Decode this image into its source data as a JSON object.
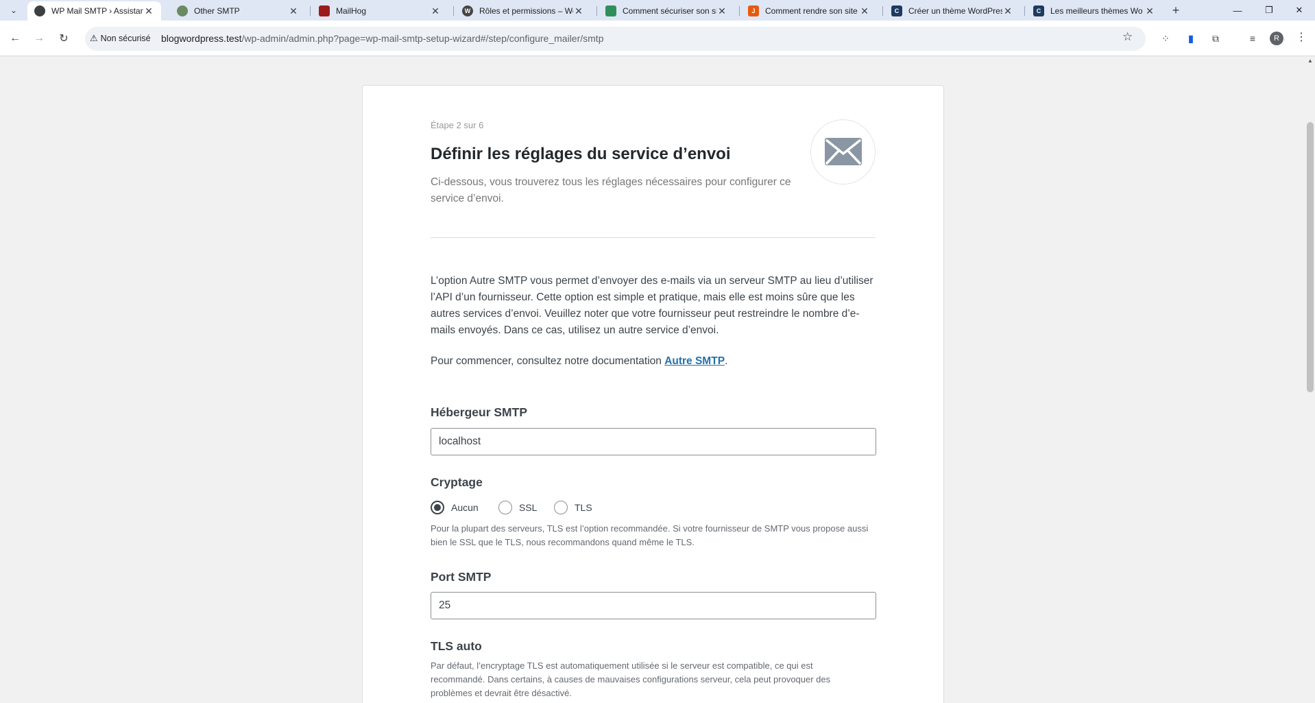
{
  "browser": {
    "tabs": [
      {
        "title": "WP Mail SMTP › Assistant",
        "active": true
      },
      {
        "title": "Other SMTP",
        "active": false
      },
      {
        "title": "MailHog",
        "active": false
      },
      {
        "title": "Rôles et permissions – Wo",
        "active": false
      },
      {
        "title": "Comment sécuriser son si",
        "active": false
      },
      {
        "title": "Comment rendre son site",
        "active": false
      },
      {
        "title": "Créer un thème WordPres",
        "active": false
      },
      {
        "title": "Les meilleurs thèmes Wo",
        "active": false
      }
    ],
    "security_label": "Non sécurisé",
    "url_host": "blogwordpress.test",
    "url_path": "/wp-admin/admin.php?page=wp-mail-smtp-setup-wizard#/step/configure_mailer/smtp",
    "profile_initial": "R"
  },
  "wizard": {
    "step": "Étape 2 sur 6",
    "title": "Définir les réglages du service d’envoi",
    "subtitle": "Ci-dessous, vous trouverez tous les réglages nécessaires pour configurer ce service d’envoi.",
    "description": "L’option Autre SMTP vous permet d’envoyer des e-mails via un serveur SMTP au lieu d’utiliser l’API d’un fournisseur. Cette option est simple et pratique, mais elle est moins sûre que les autres services d’envoi. Veuillez noter que votre fournisseur peut restreindre le nombre d’e-mails envoyés. Dans ce cas, utilisez un autre service d’envoi.",
    "doc_prefix": "Pour commencer, consultez notre documentation ",
    "doc_link": "Autre SMTP",
    "doc_suffix": ".",
    "host_label": "Hébergeur SMTP",
    "host_value": "localhost",
    "encryption_label": "Cryptage",
    "encryption_options": [
      "Aucun",
      "SSL",
      "TLS"
    ],
    "encryption_selected": "Aucun",
    "encryption_help": "Pour la plupart des serveurs, TLS est l’option recommandée. Si votre fournisseur de SMTP vous propose aussi bien le SSL que le TLS, nous recommandons quand même le TLS.",
    "port_label": "Port SMTP",
    "port_value": "25",
    "autotls_label": "TLS auto",
    "autotls_help": "Par défaut, l’encryptage TLS est automatiquement utilisée si le serveur est compatible, ce qui est recommandé. Dans certains, à causes de mauvaises configurations serveur, cela peut provoquer des problèmes et devrait être désactivé."
  }
}
